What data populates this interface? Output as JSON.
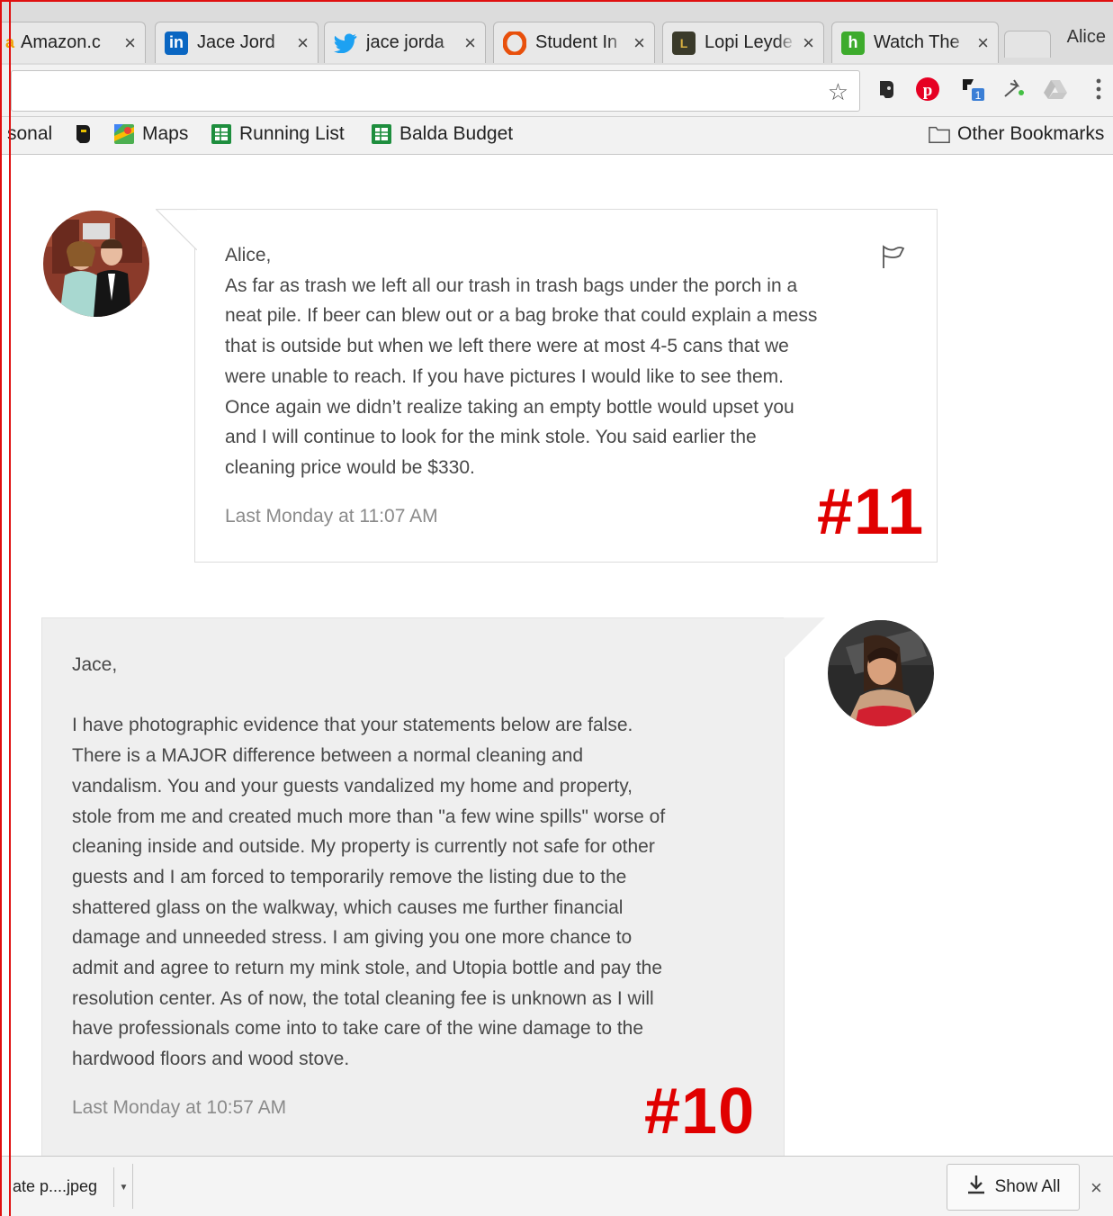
{
  "browser": {
    "tabs": [
      {
        "title": "Amazon.c",
        "icon": "amazon-icon",
        "color": "#f0a000"
      },
      {
        "title": "Jace Jord",
        "icon": "linkedin-icon",
        "color": "#0a66c2"
      },
      {
        "title": "jace jorda",
        "icon": "twitter-icon",
        "color": "#1da1f2"
      },
      {
        "title": "Student In",
        "icon": "office-icon",
        "color": "#e8500c"
      },
      {
        "title": "Lopi Leyde",
        "icon": "lopi-icon",
        "color": "#3a3a2a"
      },
      {
        "title": "Watch The",
        "icon": "hulu-icon",
        "color": "#3dab2c"
      }
    ],
    "close_glyph": "×",
    "profile_name": "Alice"
  },
  "bookmarks": {
    "items": [
      {
        "label": "sonal"
      },
      {
        "label": ""
      },
      {
        "label": "Maps"
      },
      {
        "label": "Running List"
      },
      {
        "label": "Balda Budget"
      }
    ],
    "other": "Other Bookmarks"
  },
  "messages": [
    {
      "side": "received",
      "text": "Alice,\nAs far as trash we left all our trash in trash bags under the porch in a\nneat pile. If beer can blew out or a bag broke that could explain a mess\nthat is outside but when we left there were at most 4-5 cans that we\nwere unable to reach. If you have pictures I would like to see them.\nOnce again we didn’t realize taking an empty bottle would upset you\nand I will continue to look for the mink stole. You said earlier the\ncleaning price would be $330.",
      "timestamp": "Last Monday at 11:07 AM",
      "annotation": "#11"
    },
    {
      "side": "sent",
      "text": "Jace,\n\nI have photographic evidence that your statements below are false.\nThere is a MAJOR difference between a normal cleaning and\nvandalism. You and your guests vandalized my home and property,\nstole from me and created much more than \"a few wine spills\" worse of\ncleaning inside and outside. My property is currently not safe for other\nguests and I am forced to temporarily remove the listing due to the\nshattered glass on the walkway, which causes me further financial\ndamage and unneeded stress. I am giving you one more chance to\nadmit and agree to return my mink stole, and Utopia bottle and pay the\nresolution center. As of now, the total cleaning fee is unknown as I will\nhave professionals come into to take care of the wine damage to the\nhardwood floors and wood stove.",
      "timestamp": "Last Monday at 10:57 AM",
      "annotation": "#10"
    }
  ],
  "downloads": {
    "file": "ate p....jpeg",
    "show_all": "Show All",
    "close": "×"
  }
}
